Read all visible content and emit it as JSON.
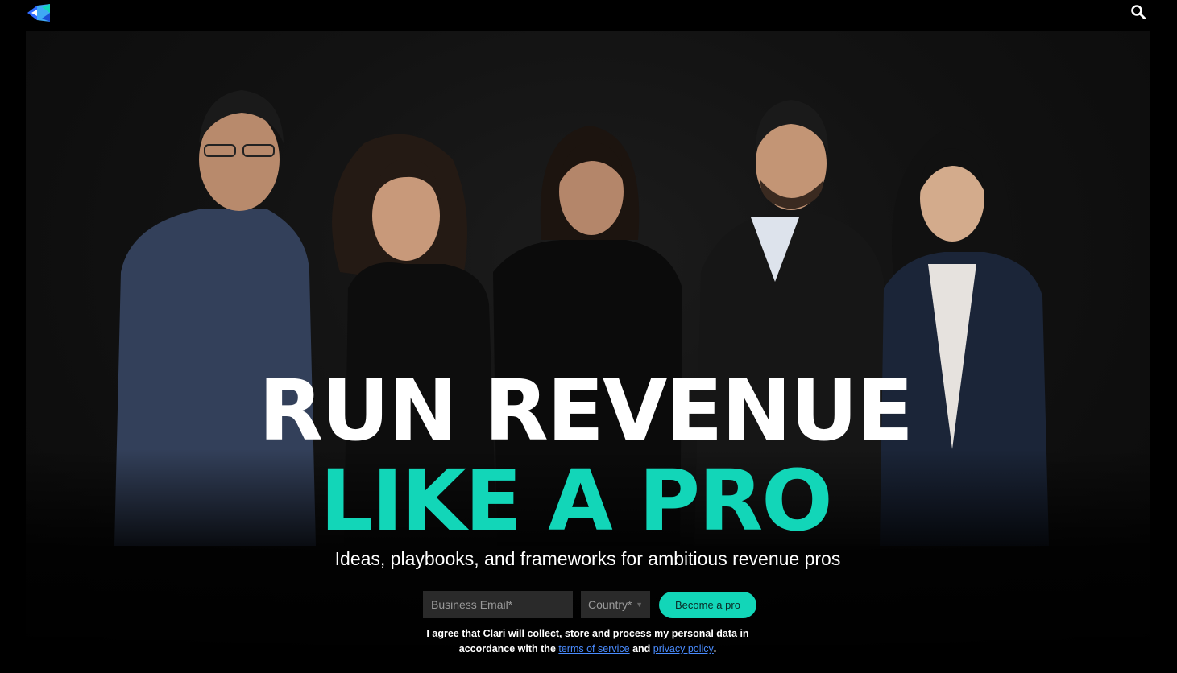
{
  "header": {
    "logo_icon": "clari-logo-icon",
    "search_icon": "search-icon"
  },
  "hero": {
    "headline_line1": "RUN REVENUE",
    "headline_line2": "LIKE A PRO",
    "subtitle": "Ideas, playbooks, and frameworks for ambitious revenue pros",
    "accent_color": "#12d6b8"
  },
  "signup_form": {
    "email_placeholder": "Business Email*",
    "email_value": "",
    "country_placeholder": "Country*",
    "submit_label": "Become a pro"
  },
  "consent": {
    "text_before": "I agree that Clari will collect, store and process my personal data in accordance with the ",
    "terms_link": "terms of service",
    "and_text": " and ",
    "privacy_link": "privacy policy",
    "period": "."
  }
}
